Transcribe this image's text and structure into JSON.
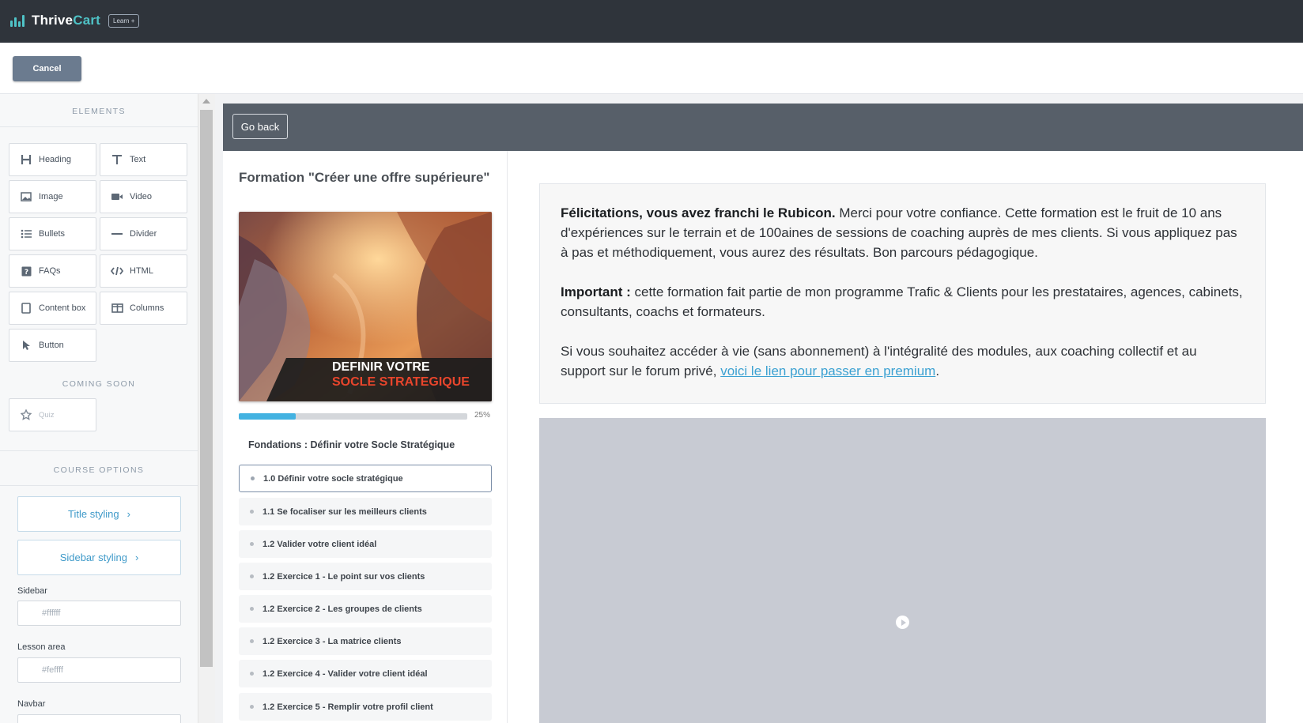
{
  "app": {
    "logo_thrive": "Thrive",
    "logo_cart": "Cart",
    "logo_badge": "Learn +"
  },
  "toolbar": {
    "cancel_label": "Cancel"
  },
  "left_panel": {
    "elements_title": "ELEMENTS",
    "elements": [
      {
        "label": "Heading",
        "icon": "heading-icon"
      },
      {
        "label": "Text",
        "icon": "text-icon"
      },
      {
        "label": "Image",
        "icon": "image-icon"
      },
      {
        "label": "Video",
        "icon": "video-icon"
      },
      {
        "label": "Bullets",
        "icon": "bullets-icon"
      },
      {
        "label": "Divider",
        "icon": "divider-icon"
      },
      {
        "label": "FAQs",
        "icon": "faqs-icon"
      },
      {
        "label": "HTML",
        "icon": "html-icon"
      },
      {
        "label": "Content box",
        "icon": "content-box-icon"
      },
      {
        "label": "Columns",
        "icon": "columns-icon"
      },
      {
        "label": "Button",
        "icon": "cursor-icon"
      }
    ],
    "coming_soon_title": "COMING SOON",
    "coming_soon": [
      {
        "label": "Quiz",
        "icon": "star-icon"
      }
    ],
    "course_options_title": "COURSE OPTIONS",
    "title_styling_label": "Title styling",
    "sidebar_styling_label": "Sidebar styling",
    "sidebar_label": "Sidebar",
    "sidebar_color_placeholder": "#ffffff",
    "lesson_area_label": "Lesson area",
    "lesson_area_placeholder": "#feffff",
    "navbar_label": "Navbar"
  },
  "preview": {
    "go_back_label": "Go back",
    "course_title": "Formation \"Créer une offre supérieure\"",
    "image_text_line1": "DEFINIR VOTRE",
    "image_text_line2": "SOCLE STRATEGIQUE",
    "progress_percent": 25,
    "progress_label": "25%",
    "module_title": "Fondations : Définir votre Socle Stratégique",
    "lessons": [
      "1.0 Définir votre socle stratégique",
      "1.1 Se focaliser sur les meilleurs clients",
      "1.2 Valider votre client idéal",
      "1.2 Exercice 1 - Le point sur vos clients",
      "1.2 Exercice 2 - Les groupes de clients",
      "1.2 Exercice 3 - La matrice clients",
      "1.2 Exercice 4 - Valider votre client idéal",
      "1.2 Exercice 5 - Remplir votre profil client"
    ],
    "intro_bold": "Félicitations, vous avez franchi le Rubicon.",
    "intro_text": " Merci pour votre confiance. Cette formation est le fruit de 10 ans d'expériences sur le terrain et de 100aines de sessions de coaching auprès de mes clients. Si vous appliquez pas à pas et méthodiquement, vous aurez des résultats. Bon parcours pédagogique.",
    "important_bold": "Important :",
    "important_text": " cette formation fait partie de mon programme Trafic & Clients pour les prestataires, agences, cabinets, consultants, coachs et formateurs.",
    "premium_text": "Si vous souhaitez accéder à vie (sans abonnement) à l'intégralité des modules, aux coaching collectif et au support sur le forum privé, ",
    "premium_link": "voici le lien pour passer en premium",
    "premium_end": "."
  },
  "colors": {
    "topbar": "#2f343b",
    "accent": "#4fc3c7",
    "link": "#3ba1d2",
    "progress": "#43b2e1",
    "image_highlight": "#e8452c"
  }
}
